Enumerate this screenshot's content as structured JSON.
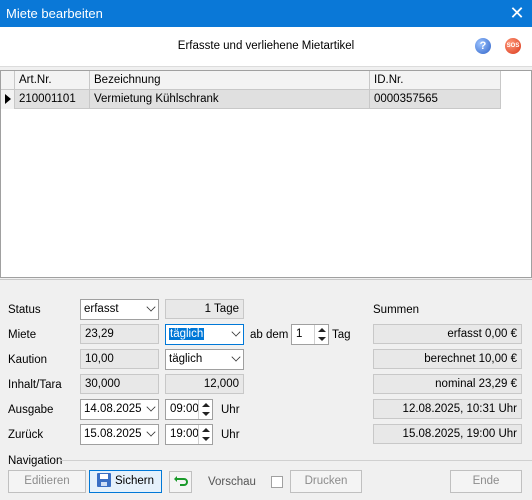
{
  "window": {
    "title": "Miete bearbeiten",
    "close_glyph": "✕"
  },
  "header": {
    "caption": "Erfasste und verliehene Mietartikel",
    "help_glyph": "?",
    "sos_label": "SOS"
  },
  "grid": {
    "columns": [
      "Art.Nr.",
      "Bezeichnung",
      "ID.Nr."
    ],
    "rows": [
      {
        "art_nr": "210001101",
        "bezeichnung": "Vermietung Kühlschrank",
        "id_nr": "0000357565"
      }
    ]
  },
  "form": {
    "status": {
      "label": "Status",
      "value": "erfasst",
      "duration": "1 Tage"
    },
    "miete": {
      "label": "Miete",
      "value": "23,29",
      "period": "täglich",
      "ab_dem_label": "ab dem",
      "ab_dem_value": "1",
      "tag_label": "Tag"
    },
    "kaution": {
      "label": "Kaution",
      "value": "10,00",
      "period": "täglich"
    },
    "inhalt": {
      "label": "Inhalt/Tara",
      "value": "30,000",
      "value2": "12,000"
    },
    "ausgabe": {
      "label": "Ausgabe",
      "date": "14.08.2025",
      "time": "09:00",
      "uhr": "Uhr"
    },
    "zurueck": {
      "label": "Zurück",
      "date": "15.08.2025",
      "time": "19:00",
      "uhr": "Uhr"
    }
  },
  "summen": {
    "title": "Summen",
    "erfasst": "erfasst 0,00 €",
    "berechnet": "berechnet 10,00 €",
    "nominal": "nominal 23,29 €",
    "ausgabe_ts": "12.08.2025, 10:31 Uhr",
    "rueck_ts": "15.08.2025, 19:00 Uhr"
  },
  "navigation": {
    "title": "Navigation",
    "editieren": "Editieren",
    "sichern": "Sichern",
    "vorschau": "Vorschau",
    "drucken": "Drucken",
    "ende": "Ende"
  }
}
